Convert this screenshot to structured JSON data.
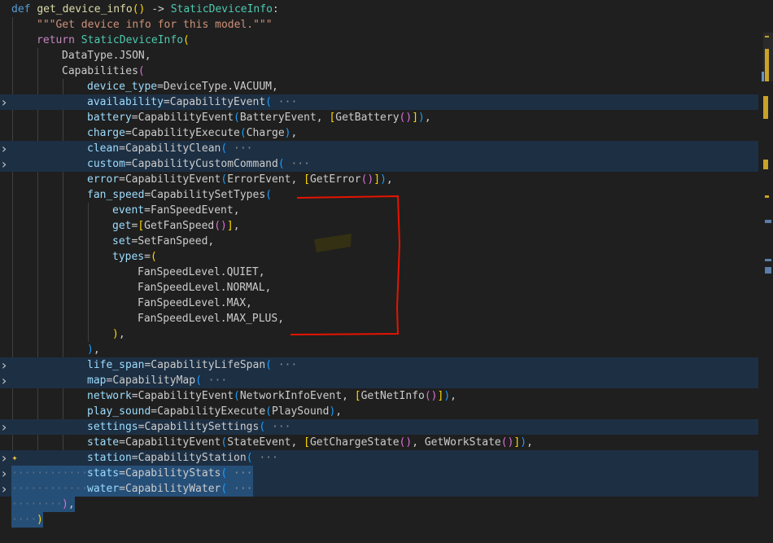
{
  "editor": {
    "lines": [
      {
        "i": 0,
        "fold": false,
        "hl": false,
        "tokens": [
          [
            "def ",
            "kw"
          ],
          [
            "get_device_info",
            "fn"
          ],
          [
            "()",
            "p1"
          ],
          [
            " -> ",
            ""
          ],
          [
            "StaticDeviceInfo",
            "cls"
          ],
          [
            ":",
            ""
          ]
        ]
      },
      {
        "i": 1,
        "fold": false,
        "hl": false,
        "tokens": [
          [
            "\"\"\"Get device info for this model.\"\"\"",
            "str"
          ]
        ]
      },
      {
        "i": 1,
        "fold": false,
        "hl": false,
        "tokens": [
          [
            "return ",
            "kwc"
          ],
          [
            "StaticDeviceInfo",
            "cls"
          ],
          [
            "(",
            "p1"
          ]
        ]
      },
      {
        "i": 2,
        "fold": false,
        "hl": false,
        "tokens": [
          [
            "DataType",
            ""
          ],
          [
            ".JSON,",
            ""
          ]
        ]
      },
      {
        "i": 2,
        "fold": false,
        "hl": false,
        "tokens": [
          [
            "Capabilities",
            ""
          ],
          [
            "(",
            "p2"
          ]
        ]
      },
      {
        "i": 3,
        "fold": false,
        "hl": false,
        "tokens": [
          [
            "device_type",
            "param"
          ],
          [
            "=",
            ""
          ],
          [
            "DeviceType",
            ""
          ],
          [
            ".VACUUM,",
            ""
          ]
        ]
      },
      {
        "i": 3,
        "fold": true,
        "hl": true,
        "tokens": [
          [
            "availability",
            "param"
          ],
          [
            "=",
            ""
          ],
          [
            "CapabilityEvent",
            ""
          ],
          [
            "(",
            "p3"
          ],
          [
            " ···",
            "fold"
          ]
        ]
      },
      {
        "i": 3,
        "fold": false,
        "hl": false,
        "tokens": [
          [
            "battery",
            "param"
          ],
          [
            "=",
            ""
          ],
          [
            "CapabilityEvent",
            ""
          ],
          [
            "(",
            "p3"
          ],
          [
            "BatteryEvent, ",
            ""
          ],
          [
            "[",
            "p1"
          ],
          [
            "GetBattery",
            ""
          ],
          [
            "()",
            "p2"
          ],
          [
            "]",
            "p1"
          ],
          [
            ")",
            "p3"
          ],
          [
            ",",
            ""
          ]
        ]
      },
      {
        "i": 3,
        "fold": false,
        "hl": false,
        "tokens": [
          [
            "charge",
            "param"
          ],
          [
            "=",
            ""
          ],
          [
            "CapabilityExecute",
            ""
          ],
          [
            "(",
            "p3"
          ],
          [
            "Charge",
            ""
          ],
          [
            ")",
            "p3"
          ],
          [
            ",",
            ""
          ]
        ]
      },
      {
        "i": 3,
        "fold": true,
        "hl": true,
        "tokens": [
          [
            "clean",
            "param"
          ],
          [
            "=",
            ""
          ],
          [
            "CapabilityClean",
            ""
          ],
          [
            "(",
            "p3"
          ],
          [
            " ···",
            "fold"
          ]
        ]
      },
      {
        "i": 3,
        "fold": true,
        "hl": true,
        "tokens": [
          [
            "custom",
            "param"
          ],
          [
            "=",
            ""
          ],
          [
            "CapabilityCustomCommand",
            ""
          ],
          [
            "(",
            "p3"
          ],
          [
            " ···",
            "fold"
          ]
        ]
      },
      {
        "i": 3,
        "fold": false,
        "hl": false,
        "tokens": [
          [
            "error",
            "param"
          ],
          [
            "=",
            ""
          ],
          [
            "CapabilityEvent",
            ""
          ],
          [
            "(",
            "p3"
          ],
          [
            "ErrorEvent, ",
            ""
          ],
          [
            "[",
            "p1"
          ],
          [
            "GetError",
            ""
          ],
          [
            "()",
            "p2"
          ],
          [
            "]",
            "p1"
          ],
          [
            ")",
            "p3"
          ],
          [
            ",",
            ""
          ]
        ]
      },
      {
        "i": 3,
        "fold": false,
        "hl": false,
        "tokens": [
          [
            "fan_speed",
            "param"
          ],
          [
            "=",
            ""
          ],
          [
            "CapabilitySetTypes",
            ""
          ],
          [
            "(",
            "p3"
          ]
        ]
      },
      {
        "i": 4,
        "fold": false,
        "hl": false,
        "tokens": [
          [
            "event",
            "param"
          ],
          [
            "=",
            ""
          ],
          [
            "FanSpeedEvent,",
            ""
          ]
        ]
      },
      {
        "i": 4,
        "fold": false,
        "hl": false,
        "tokens": [
          [
            "get",
            "param"
          ],
          [
            "=",
            ""
          ],
          [
            "[",
            "p1"
          ],
          [
            "GetFanSpeed",
            ""
          ],
          [
            "()",
            "p2"
          ],
          [
            "]",
            "p1"
          ],
          [
            ",",
            ""
          ]
        ]
      },
      {
        "i": 4,
        "fold": false,
        "hl": false,
        "tokens": [
          [
            "set",
            "param"
          ],
          [
            "=",
            ""
          ],
          [
            "SetFanSpeed,",
            ""
          ]
        ]
      },
      {
        "i": 4,
        "fold": false,
        "hl": false,
        "tokens": [
          [
            "types",
            "param"
          ],
          [
            "=",
            ""
          ],
          [
            "(",
            "p1"
          ]
        ]
      },
      {
        "i": 5,
        "fold": false,
        "hl": false,
        "tokens": [
          [
            "FanSpeedLevel",
            ""
          ],
          [
            ".QUIET,",
            ""
          ]
        ]
      },
      {
        "i": 5,
        "fold": false,
        "hl": false,
        "tokens": [
          [
            "FanSpeedLevel",
            ""
          ],
          [
            ".NORMAL,",
            ""
          ]
        ]
      },
      {
        "i": 5,
        "fold": false,
        "hl": false,
        "tokens": [
          [
            "FanSpeedLevel",
            ""
          ],
          [
            ".MAX,",
            ""
          ]
        ]
      },
      {
        "i": 5,
        "fold": false,
        "hl": false,
        "tokens": [
          [
            "FanSpeedLevel",
            ""
          ],
          [
            ".MAX_PLUS,",
            ""
          ]
        ]
      },
      {
        "i": 4,
        "fold": false,
        "hl": false,
        "tokens": [
          [
            ")",
            "p1"
          ],
          [
            ",",
            ""
          ]
        ]
      },
      {
        "i": 3,
        "fold": false,
        "hl": false,
        "tokens": [
          [
            ")",
            "p3"
          ],
          [
            ",",
            ""
          ]
        ]
      },
      {
        "i": 3,
        "fold": true,
        "hl": true,
        "tokens": [
          [
            "life_span",
            "param"
          ],
          [
            "=",
            ""
          ],
          [
            "CapabilityLifeSpan",
            ""
          ],
          [
            "(",
            "p3"
          ],
          [
            " ···",
            "fold"
          ]
        ]
      },
      {
        "i": 3,
        "fold": true,
        "hl": true,
        "tokens": [
          [
            "map",
            "param"
          ],
          [
            "=",
            ""
          ],
          [
            "CapabilityMap",
            ""
          ],
          [
            "(",
            "p3"
          ],
          [
            " ···",
            "fold"
          ]
        ]
      },
      {
        "i": 3,
        "fold": false,
        "hl": false,
        "tokens": [
          [
            "network",
            "param"
          ],
          [
            "=",
            ""
          ],
          [
            "CapabilityEvent",
            ""
          ],
          [
            "(",
            "p3"
          ],
          [
            "NetworkInfoEvent, ",
            ""
          ],
          [
            "[",
            "p1"
          ],
          [
            "GetNetInfo",
            ""
          ],
          [
            "()",
            "p2"
          ],
          [
            "]",
            "p1"
          ],
          [
            ")",
            "p3"
          ],
          [
            ",",
            ""
          ]
        ]
      },
      {
        "i": 3,
        "fold": false,
        "hl": false,
        "tokens": [
          [
            "play_sound",
            "param"
          ],
          [
            "=",
            ""
          ],
          [
            "CapabilityExecute",
            ""
          ],
          [
            "(",
            "p3"
          ],
          [
            "PlaySound",
            ""
          ],
          [
            ")",
            "p3"
          ],
          [
            ",",
            ""
          ]
        ]
      },
      {
        "i": 3,
        "fold": true,
        "hl": true,
        "tokens": [
          [
            "settings",
            "param"
          ],
          [
            "=",
            ""
          ],
          [
            "CapabilitySettings",
            ""
          ],
          [
            "(",
            "p3"
          ],
          [
            " ···",
            "fold"
          ]
        ]
      },
      {
        "i": 3,
        "fold": false,
        "hl": false,
        "tokens": [
          [
            "state",
            "param"
          ],
          [
            "=",
            ""
          ],
          [
            "CapabilityEvent",
            ""
          ],
          [
            "(",
            "p3"
          ],
          [
            "StateEvent, ",
            ""
          ],
          [
            "[",
            "p1"
          ],
          [
            "GetChargeState",
            ""
          ],
          [
            "()",
            "p2"
          ],
          [
            ", ",
            ""
          ],
          [
            "GetWorkState",
            ""
          ],
          [
            "()",
            "p2"
          ],
          [
            "]",
            "p1"
          ],
          [
            ")",
            "p3"
          ],
          [
            ",",
            ""
          ]
        ]
      },
      {
        "i": 3,
        "fold": true,
        "hl": true,
        "sparkle": true,
        "tokens": [
          [
            "station",
            "param"
          ],
          [
            "=",
            ""
          ],
          [
            "CapabilityStation",
            ""
          ],
          [
            "(",
            "p3"
          ],
          [
            " ···",
            "fold"
          ]
        ]
      },
      {
        "i": 3,
        "fold": true,
        "hl": true,
        "sel": true,
        "tokens": [
          [
            "stats",
            "param"
          ],
          [
            "=",
            ""
          ],
          [
            "CapabilityStats",
            ""
          ],
          [
            "(",
            "p3"
          ],
          [
            " ···",
            "fold"
          ]
        ]
      },
      {
        "i": 3,
        "fold": true,
        "hl": true,
        "sel": true,
        "tokens": [
          [
            "water",
            "param"
          ],
          [
            "=",
            ""
          ],
          [
            "CapabilityWater",
            ""
          ],
          [
            "(",
            "p3"
          ],
          [
            " ···",
            "fold"
          ]
        ]
      },
      {
        "i": 2,
        "fold": false,
        "hl": false,
        "sel": true,
        "tokens": [
          [
            ")",
            "p2"
          ],
          [
            ",",
            ""
          ]
        ]
      },
      {
        "i": 1,
        "fold": false,
        "hl": false,
        "sel": true,
        "tokens": [
          [
            ")",
            "p1"
          ]
        ]
      }
    ]
  },
  "colors": {
    "background": "#1f1f1f",
    "fold_highlight": "#1d2f43",
    "selection": "#264f78",
    "annotation": "#e51400"
  },
  "icons": {
    "fold": "chevron-right-icon",
    "ai": "sparkle-icon"
  }
}
